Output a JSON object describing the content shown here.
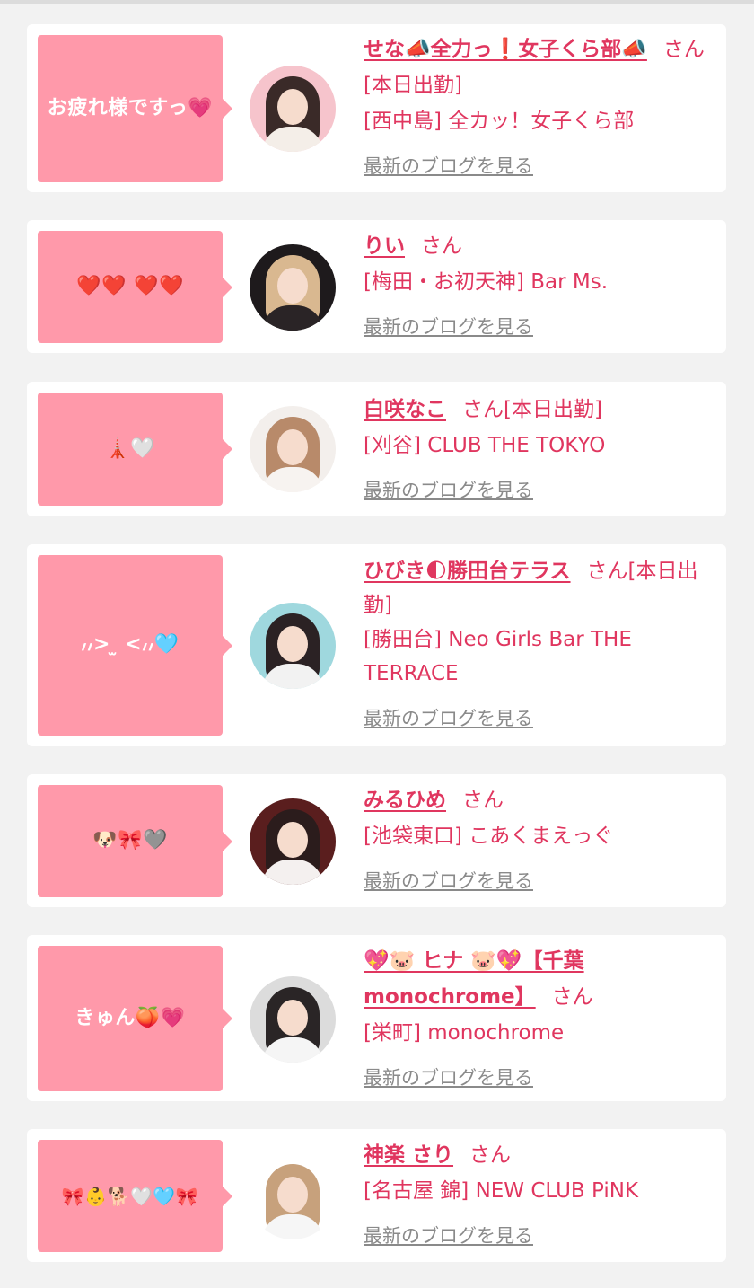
{
  "cards": [
    {
      "bubble": "お疲れ様ですっ💗",
      "name": "せな📣全力っ❗女子くら部📣",
      "san": "さん",
      "status": "[本日出勤]",
      "shop": "[西中島] 全カッ！女子くら部",
      "blog_link": "最新のブログを見る"
    },
    {
      "bubble": "❤️❤️ ❤️❤️",
      "name": "りい",
      "san": "さん",
      "status": "",
      "shop": "[梅田・お初天神] Bar Ms.",
      "blog_link": "最新のブログを見る"
    },
    {
      "bubble": "🗼🤍",
      "name": "白咲なこ",
      "san": "さん",
      "status": "[本日出勤]",
      "shop": "[刈谷] CLUB THE TOKYO",
      "blog_link": "最新のブログを見る"
    },
    {
      "bubble": "៸៸> ̫ <៸៸🩵",
      "name": "ひびき🌓勝田台テラス",
      "san": "さん",
      "status": "[本日出勤]",
      "shop": "[勝田台] Neo Girls Bar THE TERRACE",
      "blog_link": "最新のブログを見る"
    },
    {
      "bubble": "🐶🎀🩶",
      "name": "みるひめ",
      "san": "さん",
      "status": "",
      "shop": "[池袋東口] こあくまえっぐ",
      "blog_link": "最新のブログを見る"
    },
    {
      "bubble": "きゅん🍑💗",
      "name": "💖🐷 ヒナ 🐷💖【千葉monochrome】",
      "san": "さん",
      "status": "",
      "shop": "[栄町] monochrome",
      "blog_link": "最新のブログを見る"
    },
    {
      "bubble": "🎀👶🐕🤍🩵🎀",
      "name": "神楽 さり",
      "san": "さん",
      "status": "",
      "shop": "[名古屋 錦] NEW CLUB PiNK",
      "blog_link": "最新のブログを見る"
    }
  ],
  "colors": {
    "accent": "#e0365f",
    "bubble": "#ff99aa",
    "background": "#f2f2f2",
    "link_gray": "#8a8a8a"
  }
}
